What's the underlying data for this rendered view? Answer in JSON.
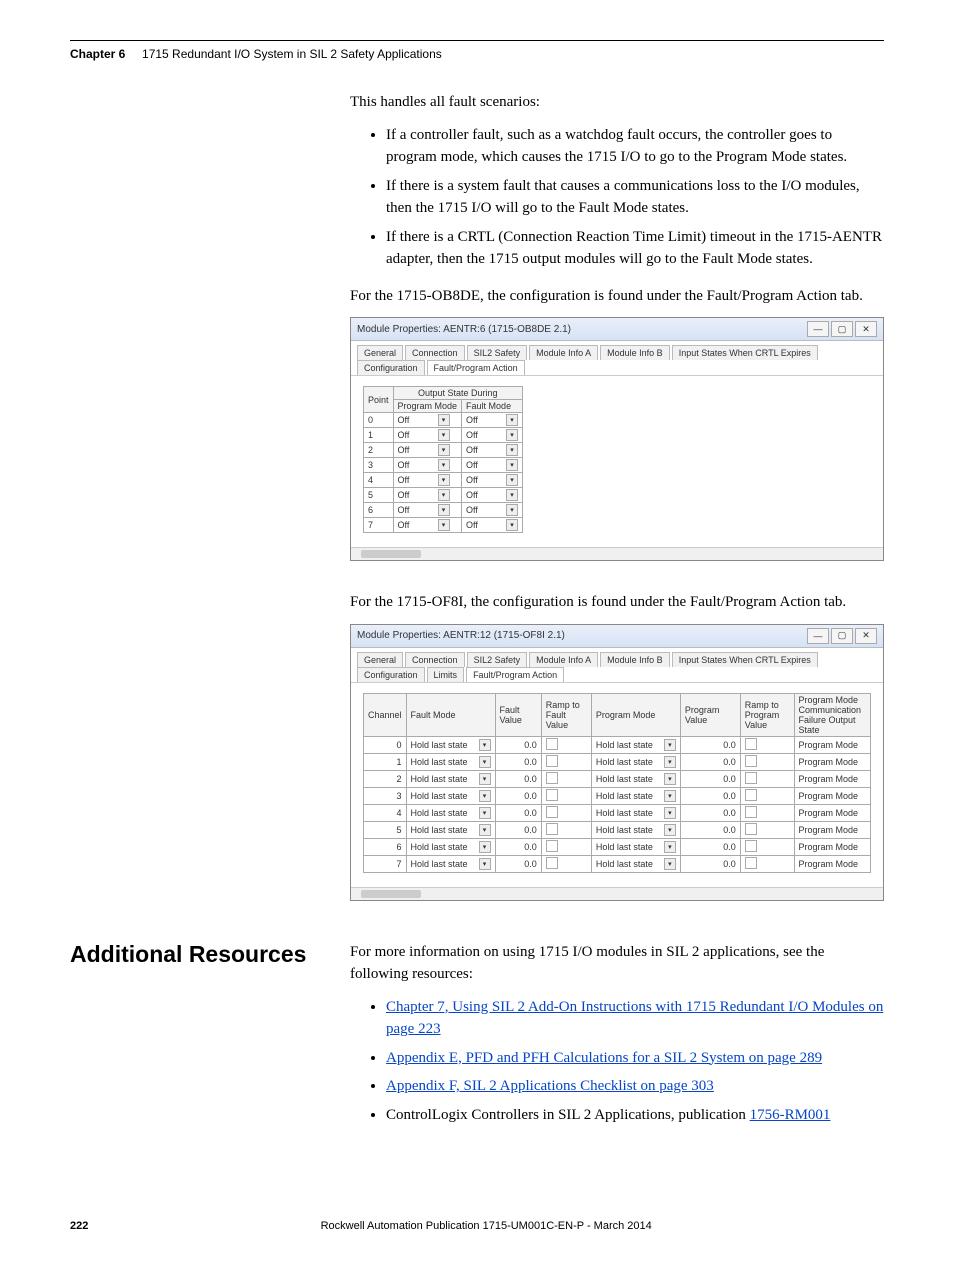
{
  "running_head": {
    "chapter": "Chapter 6",
    "title": "1715 Redundant I/O System in SIL 2 Safety Applications"
  },
  "intro_p": "This handles all fault scenarios:",
  "bullets1": [
    "If a controller fault, such as a watchdog fault occurs, the controller goes to program mode, which causes the 1715 I/O to go to the Program Mode states.",
    "If there is a system fault that causes a communications loss to the I/O modules, then the 1715 I/O will go to the Fault Mode states.",
    "If there is a CRTL (Connection Reaction Time Limit) timeout in the 1715-AENTR adapter, then the 1715 output modules will go to the Fault Mode states."
  ],
  "p2": "For the 1715-OB8DE, the configuration is found under the Fault/Program Action tab.",
  "shot1": {
    "title": "Module Properties: AENTR:6 (1715-OB8DE 2.1)",
    "tabs": [
      "General",
      "Connection",
      "SIL2 Safety",
      "Module Info A",
      "Module Info B",
      "Input States When CRTL Expires",
      "Configuration",
      "Fault/Program Action"
    ],
    "active_tab": 7,
    "table": {
      "super_header": "Output State During",
      "headers": [
        "Point",
        "Program Mode",
        "Fault Mode"
      ],
      "rows": [
        [
          "0",
          "Off",
          "Off"
        ],
        [
          "1",
          "Off",
          "Off"
        ],
        [
          "2",
          "Off",
          "Off"
        ],
        [
          "3",
          "Off",
          "Off"
        ],
        [
          "4",
          "Off",
          "Off"
        ],
        [
          "5",
          "Off",
          "Off"
        ],
        [
          "6",
          "Off",
          "Off"
        ],
        [
          "7",
          "Off",
          "Off"
        ]
      ]
    }
  },
  "p3": "For the 1715-OF8I, the configuration is found under the Fault/Program Action tab.",
  "shot2": {
    "title": "Module Properties: AENTR:12 (1715-OF8I 2.1)",
    "tabs": [
      "General",
      "Connection",
      "SIL2 Safety",
      "Module Info A",
      "Module Info B",
      "Input States When CRTL Expires",
      "Configuration",
      "Limits",
      "Fault/Program Action"
    ],
    "active_tab": 8,
    "headers": [
      "Channel",
      "Fault Mode",
      "Fault Value",
      "Ramp to Fault Value",
      "Program Mode",
      "Program Value",
      "Ramp to Program Value",
      "Program Mode Communication Failure Output State"
    ],
    "rows": [
      [
        "0",
        "Hold last state",
        "0.0",
        "",
        "Hold last state",
        "0.0",
        "",
        "Program Mode"
      ],
      [
        "1",
        "Hold last state",
        "0.0",
        "",
        "Hold last state",
        "0.0",
        "",
        "Program Mode"
      ],
      [
        "2",
        "Hold last state",
        "0.0",
        "",
        "Hold last state",
        "0.0",
        "",
        "Program Mode"
      ],
      [
        "3",
        "Hold last state",
        "0.0",
        "",
        "Hold last state",
        "0.0",
        "",
        "Program Mode"
      ],
      [
        "4",
        "Hold last state",
        "0.0",
        "",
        "Hold last state",
        "0.0",
        "",
        "Program Mode"
      ],
      [
        "5",
        "Hold last state",
        "0.0",
        "",
        "Hold last state",
        "0.0",
        "",
        "Program Mode"
      ],
      [
        "6",
        "Hold last state",
        "0.0",
        "",
        "Hold last state",
        "0.0",
        "",
        "Program Mode"
      ],
      [
        "7",
        "Hold last state",
        "0.0",
        "",
        "Hold last state",
        "0.0",
        "",
        "Program Mode"
      ]
    ]
  },
  "additional": {
    "heading": "Additional Resources",
    "intro": "For more information on using 1715 I/O modules in SIL 2 applications, see the following resources:",
    "items": [
      {
        "text": "Chapter 7, Using SIL 2 Add-On Instructions with 1715 Redundant I/O Modules on page 223",
        "link": true
      },
      {
        "text": "Appendix E, PFD and PFH Calculations for a SIL 2 System on page 289",
        "link": true
      },
      {
        "text": "Appendix F, SIL 2 Applications Checklist on page 303",
        "link": true
      },
      {
        "prefix": "ControlLogix Controllers in SIL 2 Applications, publication ",
        "text": "1756-RM001",
        "link": true
      }
    ]
  },
  "footer": {
    "page": "222",
    "pub": "Rockwell Automation Publication 1715-UM001C-EN-P - March 2014"
  }
}
